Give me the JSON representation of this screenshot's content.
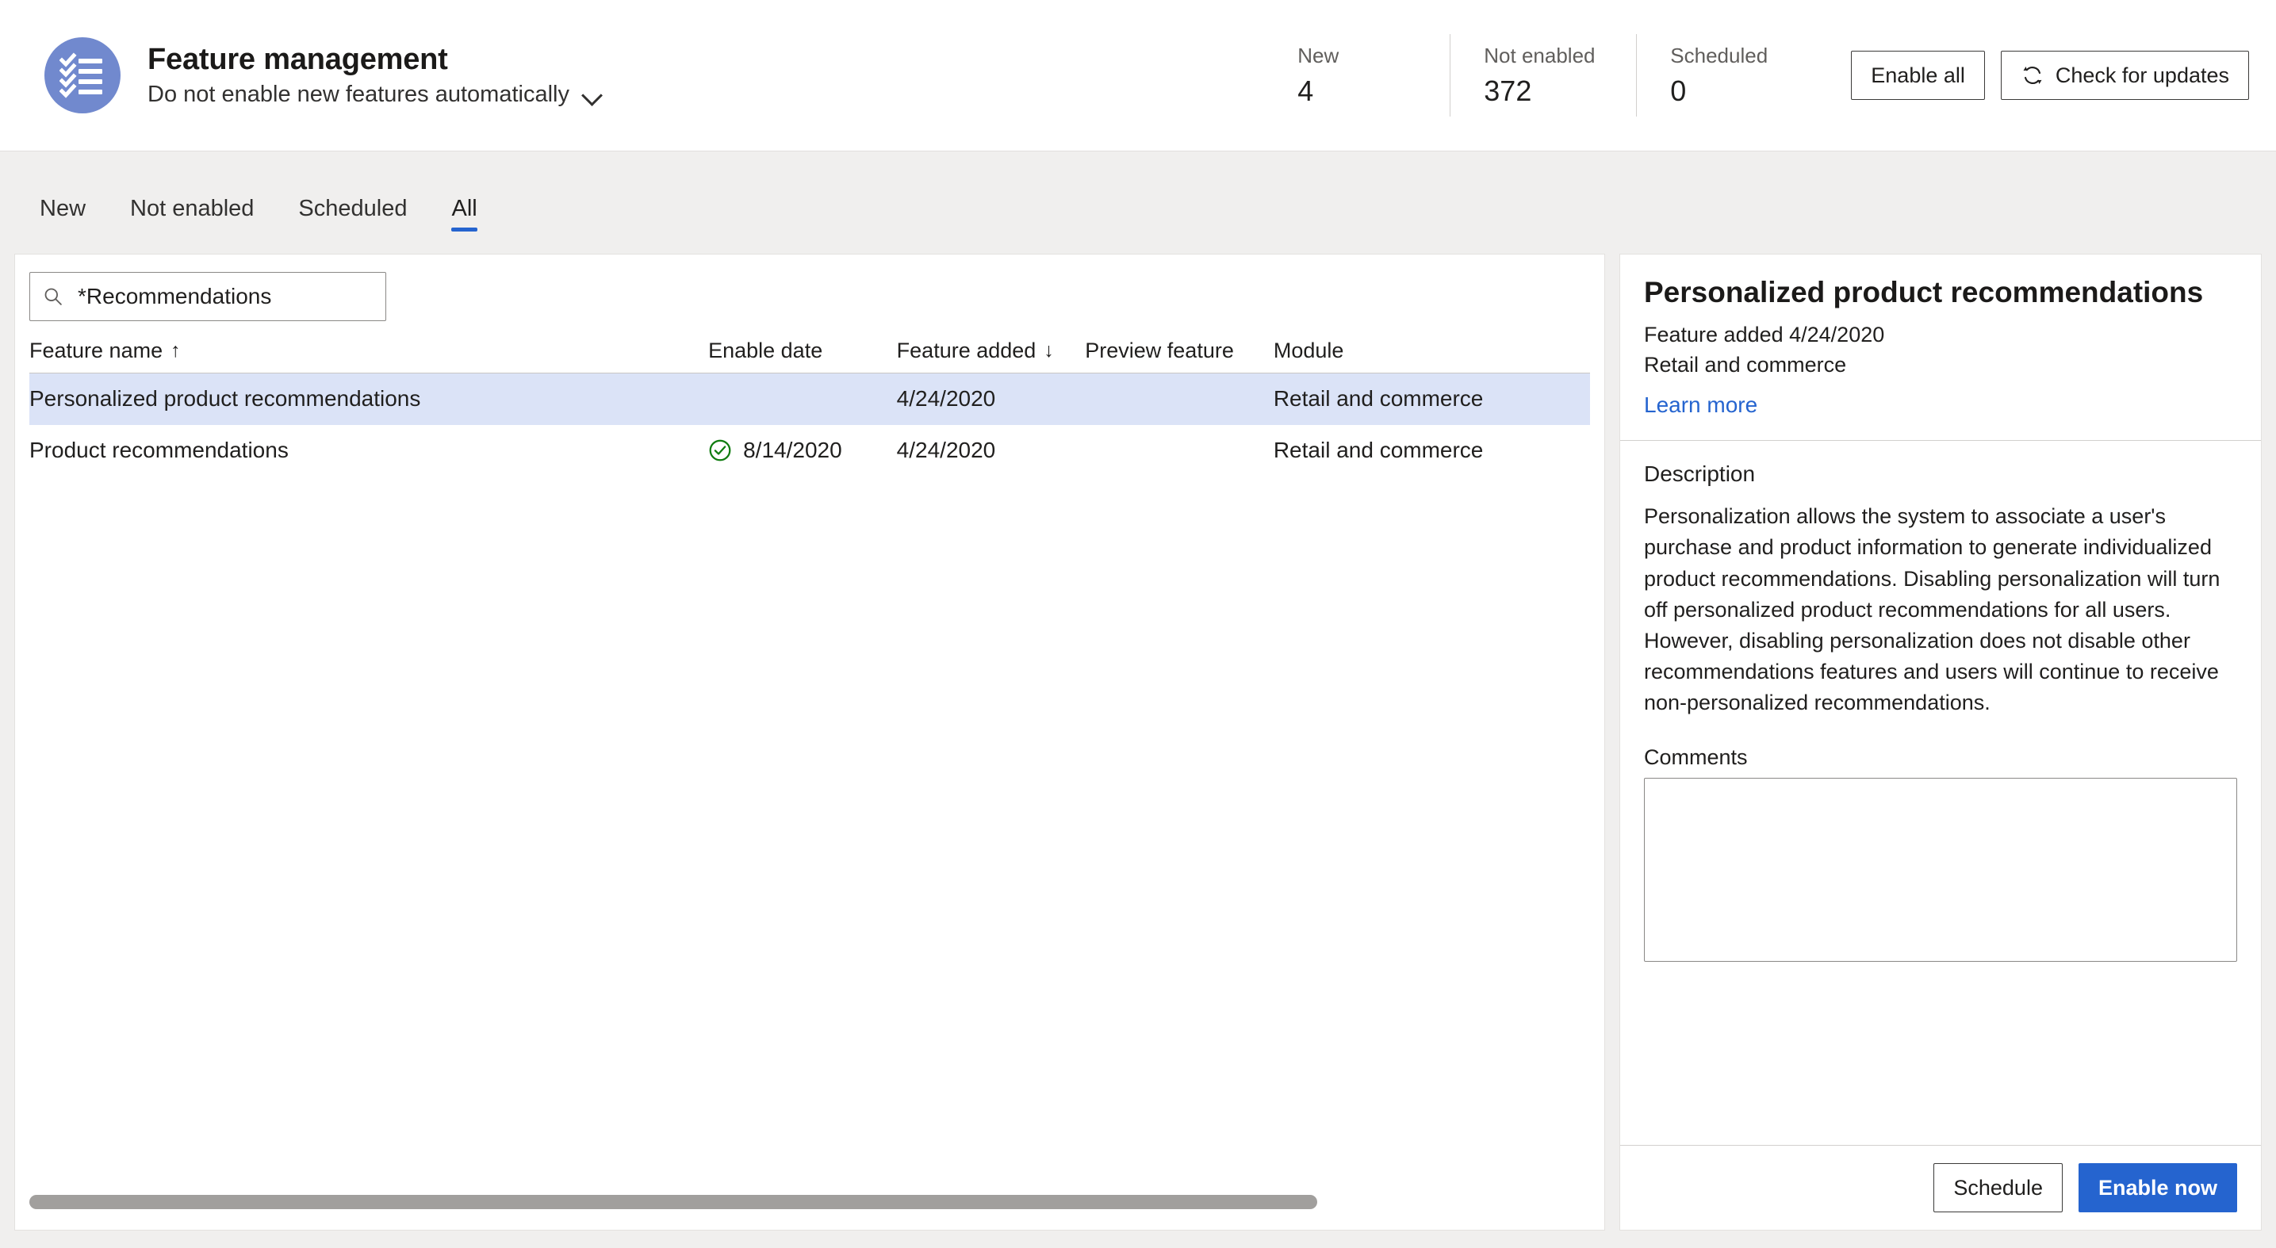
{
  "header": {
    "logo_icon": "checklist-icon",
    "title": "Feature management",
    "subtitle": "Do not enable new features automatically",
    "subtitle_chevron_icon": "chevron-down-icon",
    "stats": [
      {
        "label": "New",
        "value": "4"
      },
      {
        "label": "Not enabled",
        "value": "372"
      },
      {
        "label": "Scheduled",
        "value": "0"
      }
    ],
    "actions": {
      "enable_all": "Enable all",
      "check_for_updates": "Check for updates",
      "check_for_updates_icon": "refresh-icon"
    }
  },
  "tabs": [
    {
      "label": "New",
      "active": false
    },
    {
      "label": "Not enabled",
      "active": false
    },
    {
      "label": "Scheduled",
      "active": false
    },
    {
      "label": "All",
      "active": true
    }
  ],
  "search": {
    "icon": "search-icon",
    "value": "*Recommendations",
    "placeholder": "Filter"
  },
  "grid": {
    "columns": [
      {
        "key": "name",
        "label": "Feature name",
        "sort": "↑"
      },
      {
        "key": "enable_date",
        "label": "Enable date",
        "sort": ""
      },
      {
        "key": "feature_added",
        "label": "Feature added",
        "sort": "↓"
      },
      {
        "key": "preview_feature",
        "label": "Preview feature",
        "sort": ""
      },
      {
        "key": "module",
        "label": "Module",
        "sort": ""
      }
    ],
    "rows": [
      {
        "name": "Personalized product recommendations",
        "enabled_icon": "",
        "enable_date": "",
        "feature_added": "4/24/2020",
        "preview_feature": "",
        "module": "Retail and commerce",
        "selected": true
      },
      {
        "name": "Product recommendations",
        "enabled_icon": "check-circle-icon",
        "enable_date": "8/14/2020",
        "feature_added": "4/24/2020",
        "preview_feature": "",
        "module": "Retail and commerce",
        "selected": false
      }
    ]
  },
  "detail": {
    "title": "Personalized product recommendations",
    "feature_added": "Feature added 4/24/2020",
    "module": "Retail and commerce",
    "learn_more": "Learn more",
    "description_label": "Description",
    "description": "Personalization allows the system to associate a user's purchase and product information to generate individualized product recommendations. Disabling personalization will turn off personalized product recommendations for all users. However, disabling personalization does not disable other recommendations features and users will continue to receive non-personalized recommendations.",
    "comments_label": "Comments",
    "comments_value": "",
    "footer": {
      "schedule": "Schedule",
      "enable_now": "Enable now"
    }
  },
  "colors": {
    "accent": "#2564cf",
    "logo_bg": "#7189ce",
    "row_selected": "#dbe3f7",
    "enabled_check": "#107c10",
    "page_bg": "#f0efee"
  }
}
